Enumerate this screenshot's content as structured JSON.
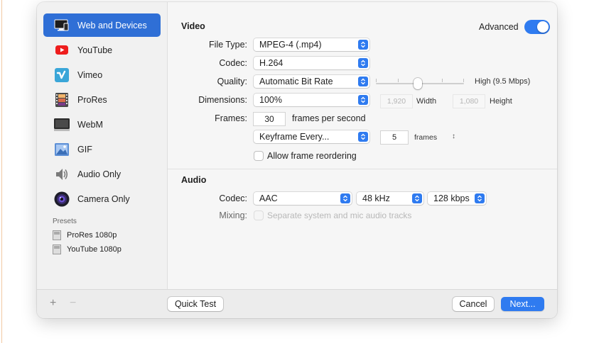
{
  "sidebar": {
    "items": [
      {
        "label": "Web and Devices",
        "icon": "monitor-icon",
        "selected": true
      },
      {
        "label": "YouTube",
        "icon": "youtube-icon"
      },
      {
        "label": "Vimeo",
        "icon": "vimeo-icon"
      },
      {
        "label": "ProRes",
        "icon": "film-icon"
      },
      {
        "label": "WebM",
        "icon": "webm-icon"
      },
      {
        "label": "GIF",
        "icon": "gif-icon"
      },
      {
        "label": "Audio Only",
        "icon": "speaker-icon"
      },
      {
        "label": "Camera Only",
        "icon": "camera-icon"
      }
    ],
    "presets_label": "Presets",
    "presets": [
      "ProRes 1080p",
      "YouTube 1080p"
    ]
  },
  "video": {
    "title": "Video",
    "advanced_label": "Advanced",
    "advanced_on": true,
    "file_type_label": "File Type:",
    "file_type_value": "MPEG-4 (.mp4)",
    "codec_label": "Codec:",
    "codec_value": "H.264",
    "quality_label": "Quality:",
    "quality_value": "Automatic Bit Rate",
    "quality_level_label": "High (9.5 Mbps)",
    "quality_slider_fraction": 0.5,
    "dimensions_label": "Dimensions:",
    "dimensions_value": "100%",
    "width_value": "1,920",
    "width_label": "Width",
    "height_value": "1,080",
    "height_label": "Height",
    "frames_label": "Frames:",
    "frames_value": "30",
    "frames_unit": "frames per second",
    "keyframe_value": "Keyframe Every...",
    "keyframe_count": "5",
    "keyframe_unit": "frames",
    "reorder_label": "Allow frame reordering"
  },
  "audio": {
    "title": "Audio",
    "codec_label": "Codec:",
    "codec_value": "AAC",
    "sample_rate": "48 kHz",
    "bitrate": "128 kbps",
    "mixing_label": "Mixing:",
    "mixing_option": "Separate system and mic audio tracks"
  },
  "footer": {
    "add": "+",
    "remove": "−",
    "quick_test": "Quick Test",
    "cancel": "Cancel",
    "next": "Next..."
  },
  "colors": {
    "accent": "#2f7bf0",
    "selected": "#2f6fd6"
  }
}
